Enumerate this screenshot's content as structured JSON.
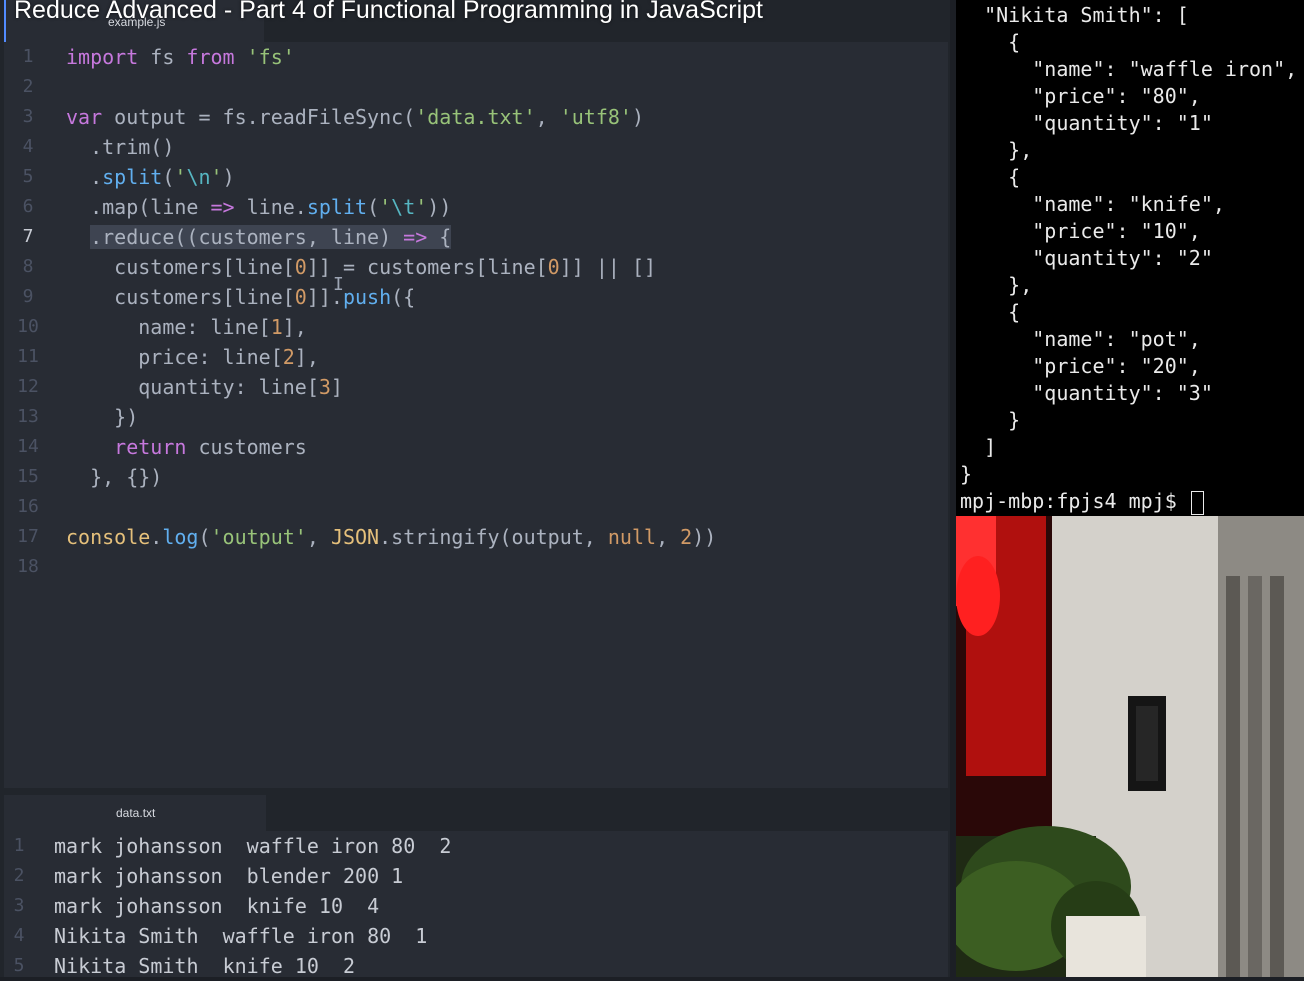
{
  "video": {
    "title": "Reduce Advanced - Part 4 of Functional Programming in JavaScript"
  },
  "editor": {
    "top_tab": "example.js",
    "bottom_tab": "data.txt",
    "active_line": 7,
    "code_lines": [
      {
        "n": "1",
        "html": "<span class=\"kw\">import</span> fs <span class=\"kw\">from</span> <span class=\"str\">'fs'</span>"
      },
      {
        "n": "2",
        "html": ""
      },
      {
        "n": "3",
        "html": "<span class=\"kw\">var</span> output = fs.readFileSync(<span class=\"str\">'data.txt'</span>, <span class=\"str\">'utf8'</span>)"
      },
      {
        "n": "4",
        "html": "  .trim()"
      },
      {
        "n": "5",
        "html": "  .<span class=\"fn\">split</span>(<span class=\"str\">'<span class=\"op\">\\n</span>'</span>)"
      },
      {
        "n": "6",
        "html": "  .map(line <span class=\"kw\">=&gt;</span> line.<span class=\"fn\">split</span>(<span class=\"str\">'<span class=\"op\">\\t</span>'</span>))"
      },
      {
        "n": "7",
        "html": "  <span class=\"sel\">.reduce((customers, line) <span class=\"kw\">=&gt;</span> {</span>"
      },
      {
        "n": "8",
        "html": "    customers[line[<span class=\"num\">0</span>]] = customers[line[<span class=\"num\">0</span>]] || []"
      },
      {
        "n": "9",
        "html": "    customers[line[<span class=\"num\">0</span>]].<span class=\"fn\">push</span>({"
      },
      {
        "n": "10",
        "html": "      name: line[<span class=\"num\">1</span>],"
      },
      {
        "n": "11",
        "html": "      price: line[<span class=\"num\">2</span>],"
      },
      {
        "n": "12",
        "html": "      quantity: line[<span class=\"num\">3</span>]"
      },
      {
        "n": "13",
        "html": "    })"
      },
      {
        "n": "14",
        "html": "    <span class=\"kw\">return</span> customers"
      },
      {
        "n": "15",
        "html": "  }, {})"
      },
      {
        "n": "16",
        "html": ""
      },
      {
        "n": "17",
        "html": "<span class=\"cls\">console</span>.<span class=\"fn\">log</span>(<span class=\"str\">'output'</span>, <span class=\"cls\">JSON</span>.stringify(output, <span class=\"num\">null</span>, <span class=\"num\">2</span>))"
      },
      {
        "n": "18",
        "html": ""
      }
    ],
    "data_lines": [
      {
        "n": "1",
        "text": "mark johansson  waffle iron 80  2"
      },
      {
        "n": "2",
        "text": "mark johansson  blender 200 1"
      },
      {
        "n": "3",
        "text": "mark johansson  knife 10  4"
      },
      {
        "n": "4",
        "text": "Nikita Smith  waffle iron 80  1"
      },
      {
        "n": "5",
        "text": "Nikita Smith  knife 10  2"
      }
    ]
  },
  "terminal": {
    "lines": [
      "  \"Nikita Smith\": [",
      "    {",
      "      \"name\": \"waffle iron\",",
      "      \"price\": \"80\",",
      "      \"quantity\": \"1\"",
      "    },",
      "    {",
      "      \"name\": \"knife\",",
      "      \"price\": \"10\",",
      "      \"quantity\": \"2\"",
      "    },",
      "    {",
      "      \"name\": \"pot\",",
      "      \"price\": \"20\",",
      "      \"quantity\": \"3\"",
      "    }",
      "  ]",
      "}"
    ],
    "prompt": "mpj-mbp:fpjs4 mpj$ "
  },
  "colors": {
    "editor_bg": "#282c34",
    "keyword": "#c678dd",
    "string": "#98c379",
    "function": "#61afef",
    "number": "#d19a66",
    "terminal_bg": "#000000"
  }
}
